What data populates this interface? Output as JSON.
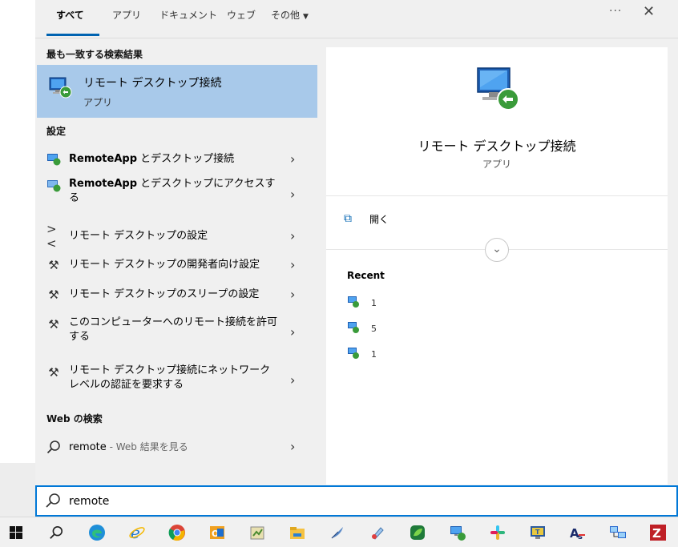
{
  "tabs": [
    {
      "label": "すべて"
    },
    {
      "label": "アプリ"
    },
    {
      "label": "ドキュメント"
    },
    {
      "label": "ウェブ"
    },
    {
      "label": "その他"
    }
  ],
  "tabbar": {
    "ellipsis": "···",
    "close": "✕"
  },
  "best_match": {
    "section": "最も一致する検索結果",
    "title": "リモート デスクトップ接続",
    "subtitle": "アプリ"
  },
  "settings": {
    "section": "設定",
    "items": [
      {
        "bold": "RemoteApp",
        "text": " とデスクトップ接続"
      },
      {
        "bold": "RemoteApp",
        "text": " とデスクトップにアクセスする"
      },
      {
        "bold": "",
        "text": "リモート デスクトップの設定"
      },
      {
        "bold": "",
        "text": "リモート デスクトップの開発者向け設定"
      },
      {
        "bold": "",
        "text": "リモート デスクトップのスリープの設定"
      },
      {
        "bold": "",
        "text": "このコンピューターへのリモート接続を許可する"
      },
      {
        "bold": "",
        "text": "リモート デスクトップ接続にネットワーク レベルの認証を要求する"
      }
    ]
  },
  "web": {
    "section": "Web の検索",
    "query": "remote",
    "suffix": " - Web 結果を見る"
  },
  "preview": {
    "title": "リモート デスクトップ接続",
    "subtitle": "アプリ",
    "open_label": "開く",
    "recent_label": "Recent",
    "recent": [
      {
        "text": "1"
      },
      {
        "text": "5"
      },
      {
        "text": "1"
      }
    ]
  },
  "search": {
    "value": "remote"
  },
  "colors": {
    "accent": "#0063b1",
    "selection": "#a8c9ea",
    "search_border": "#0078d7"
  },
  "taskbar": [
    {
      "icon": "windows-start-icon"
    },
    {
      "icon": "search-icon"
    },
    {
      "icon": "edge-icon"
    },
    {
      "icon": "internet-explorer-icon"
    },
    {
      "icon": "chrome-icon"
    },
    {
      "icon": "outlook-icon"
    },
    {
      "icon": "notepad-app-icon"
    },
    {
      "icon": "file-explorer-icon"
    },
    {
      "icon": "feather-app-icon"
    },
    {
      "icon": "paint-app-icon"
    },
    {
      "icon": "green-app-icon"
    },
    {
      "icon": "remote-desktop-icon"
    },
    {
      "icon": "slack-icon"
    },
    {
      "icon": "monitor-app-icon"
    },
    {
      "icon": "acrobat-app-icon"
    },
    {
      "icon": "network-app-icon"
    },
    {
      "icon": "filezilla-icon"
    }
  ]
}
